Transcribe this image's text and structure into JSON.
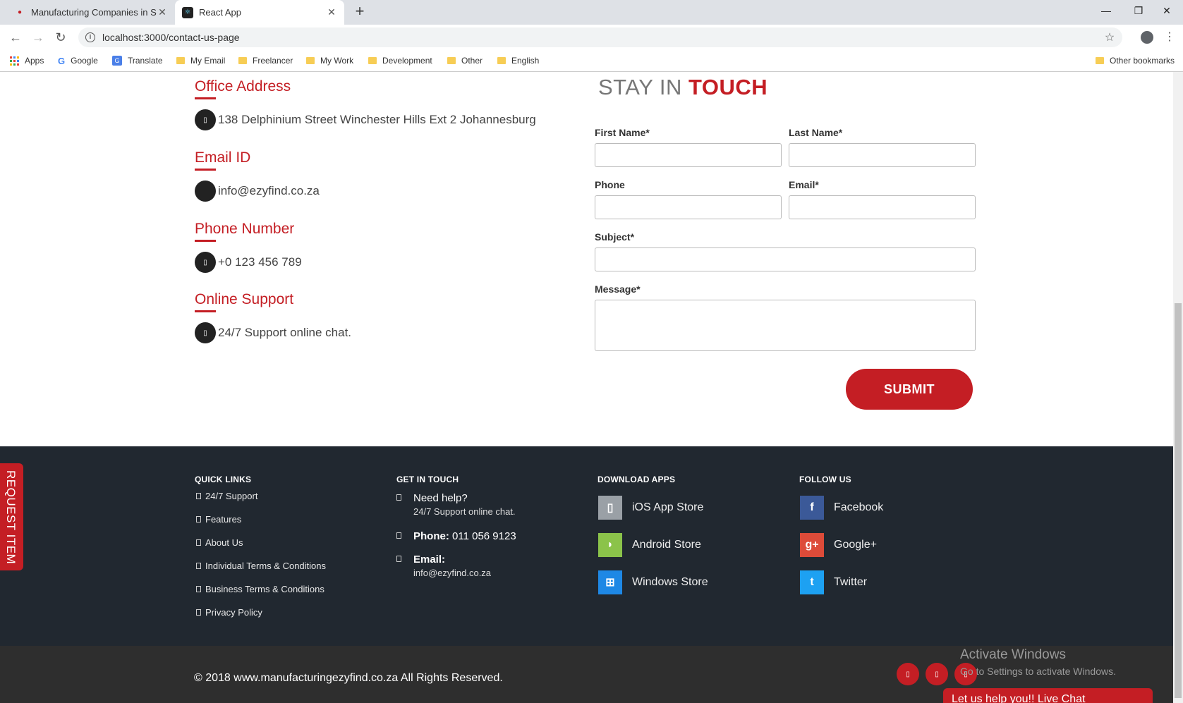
{
  "browser": {
    "tabs": [
      {
        "title": "Manufacturing Companies in Sou",
        "active": false
      },
      {
        "title": "React App",
        "active": true
      }
    ],
    "url": "localhost:3000/contact-us-page",
    "bookmarks": [
      "Apps",
      "Google",
      "Translate",
      "My Email",
      "Freelancer",
      "My Work",
      "Development",
      "Other",
      "English"
    ],
    "other_bookmarks": "Other bookmarks"
  },
  "contact_info": {
    "office": {
      "title": "Office Address",
      "value": "138 Delphinium Street Winchester Hills Ext 2 Johannesburg"
    },
    "email": {
      "title": "Email ID",
      "value": "info@ezyfind.co.za"
    },
    "phone": {
      "title": "Phone Number",
      "value": "+0 123 456 789"
    },
    "support": {
      "title": "Online Support",
      "value": "24/7 Support online chat."
    }
  },
  "form": {
    "title_light": "STAY IN",
    "title_bold": "TOUCH",
    "first_name": "First Name*",
    "last_name": "Last Name*",
    "phone": "Phone",
    "email": "Email*",
    "subject": "Subject*",
    "message": "Message*",
    "submit": "SUBMIT"
  },
  "request_item": "REQUEST ITEM",
  "footer": {
    "quick_links": {
      "title": "QUICK LINKS",
      "items": [
        "24/7 Support",
        "Features",
        "About Us",
        "Individual Terms & Conditions",
        "Business Terms & Conditions",
        "Privacy Policy"
      ]
    },
    "get_in_touch": {
      "title": "GET IN TOUCH",
      "help_title": "Need help?",
      "help_sub": "24/7 Support online chat.",
      "phone_label": "Phone:",
      "phone_value": "011 056 9123",
      "email_label": "Email:",
      "email_value": "info@ezyfind.co.za"
    },
    "download_apps": {
      "title": "DOWNLOAD APPS",
      "items": [
        {
          "label": "iOS App Store",
          "icon": "apple-icon",
          "color": "#9aa0a6"
        },
        {
          "label": "Android Store",
          "icon": "android-icon",
          "color": "#8bc34a"
        },
        {
          "label": "Windows Store",
          "icon": "windows-icon",
          "color": "#1e88e5"
        }
      ]
    },
    "follow_us": {
      "title": "FOLLOW US",
      "items": [
        {
          "label": "Facebook",
          "icon": "facebook-icon",
          "color": "#3b5998"
        },
        {
          "label": "Google+",
          "icon": "google-plus-icon",
          "color": "#dd4b39"
        },
        {
          "label": "Twitter",
          "icon": "twitter-icon",
          "color": "#1da1f2"
        }
      ]
    }
  },
  "bottom": {
    "copyright": "© 2018 www.manufacturingezyfind.co.za All Rights Reserved.",
    "activate_title": "Activate Windows",
    "activate_sub": "Go to Settings to activate Windows.",
    "live_chat": "Let us help you!! Live Chat"
  },
  "colors": {
    "accent": "#c41e24",
    "footer_bg": "#212830",
    "bottom_bg": "#2e2e2e"
  }
}
